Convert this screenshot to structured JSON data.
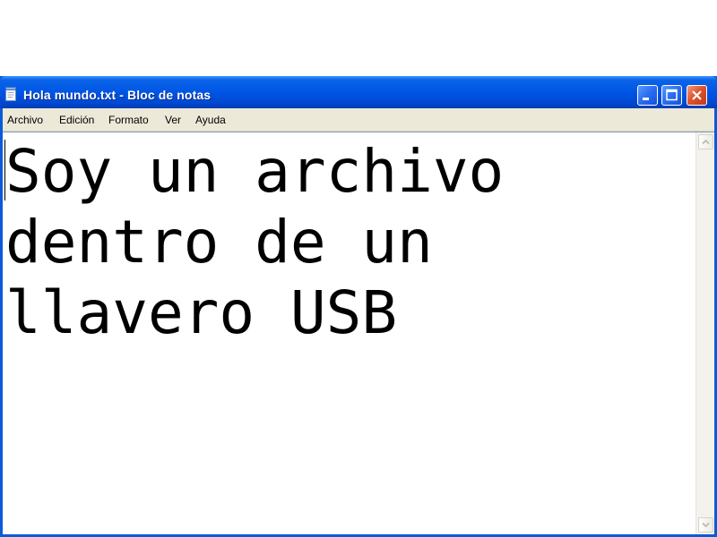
{
  "window": {
    "title": "Hola mundo.txt - Bloc de notas",
    "app_icon": "notepad-icon",
    "controls": {
      "minimize_icon": "minimize-icon",
      "maximize_icon": "maximize-icon",
      "close_icon": "close-icon"
    },
    "colors": {
      "titlebar": "#0055e5",
      "close_button": "#e0532d",
      "menubar": "#ece9d8"
    }
  },
  "menu": {
    "items": [
      "Archivo",
      "Edición",
      "Formato",
      "Ver",
      "Ayuda"
    ]
  },
  "document": {
    "text": "Soy un archivo\ndentro de un\nllavero USB"
  },
  "scrollbar": {
    "up_icon": "scroll-up-arrow-icon",
    "down_icon": "scroll-down-arrow-icon"
  }
}
